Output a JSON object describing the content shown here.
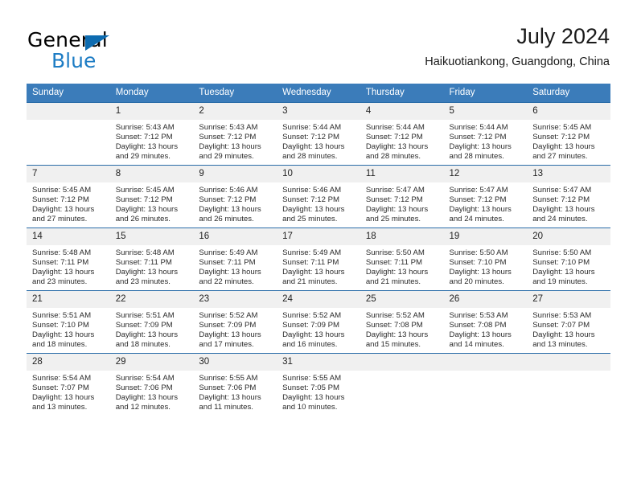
{
  "brand": {
    "name_top": "General",
    "name_bottom": "Blue",
    "triangle_color": "#0d6bb0",
    "blue_color": "#1d7cc4"
  },
  "header": {
    "title": "July 2024",
    "subtitle": "Haikuotiankong, Guangdong, China"
  },
  "theme": {
    "header_bg": "#3b7cba",
    "row_rule": "#2a6ca8",
    "daynum_bg": "#f0f0f0"
  },
  "weekdays": [
    "Sunday",
    "Monday",
    "Tuesday",
    "Wednesday",
    "Thursday",
    "Friday",
    "Saturday"
  ],
  "weeks": [
    [
      {
        "day": "",
        "sunrise": "",
        "sunset": "",
        "daylight1": "",
        "daylight2": ""
      },
      {
        "day": "1",
        "sunrise": "Sunrise: 5:43 AM",
        "sunset": "Sunset: 7:12 PM",
        "daylight1": "Daylight: 13 hours",
        "daylight2": "and 29 minutes."
      },
      {
        "day": "2",
        "sunrise": "Sunrise: 5:43 AM",
        "sunset": "Sunset: 7:12 PM",
        "daylight1": "Daylight: 13 hours",
        "daylight2": "and 29 minutes."
      },
      {
        "day": "3",
        "sunrise": "Sunrise: 5:44 AM",
        "sunset": "Sunset: 7:12 PM",
        "daylight1": "Daylight: 13 hours",
        "daylight2": "and 28 minutes."
      },
      {
        "day": "4",
        "sunrise": "Sunrise: 5:44 AM",
        "sunset": "Sunset: 7:12 PM",
        "daylight1": "Daylight: 13 hours",
        "daylight2": "and 28 minutes."
      },
      {
        "day": "5",
        "sunrise": "Sunrise: 5:44 AM",
        "sunset": "Sunset: 7:12 PM",
        "daylight1": "Daylight: 13 hours",
        "daylight2": "and 28 minutes."
      },
      {
        "day": "6",
        "sunrise": "Sunrise: 5:45 AM",
        "sunset": "Sunset: 7:12 PM",
        "daylight1": "Daylight: 13 hours",
        "daylight2": "and 27 minutes."
      }
    ],
    [
      {
        "day": "7",
        "sunrise": "Sunrise: 5:45 AM",
        "sunset": "Sunset: 7:12 PM",
        "daylight1": "Daylight: 13 hours",
        "daylight2": "and 27 minutes."
      },
      {
        "day": "8",
        "sunrise": "Sunrise: 5:45 AM",
        "sunset": "Sunset: 7:12 PM",
        "daylight1": "Daylight: 13 hours",
        "daylight2": "and 26 minutes."
      },
      {
        "day": "9",
        "sunrise": "Sunrise: 5:46 AM",
        "sunset": "Sunset: 7:12 PM",
        "daylight1": "Daylight: 13 hours",
        "daylight2": "and 26 minutes."
      },
      {
        "day": "10",
        "sunrise": "Sunrise: 5:46 AM",
        "sunset": "Sunset: 7:12 PM",
        "daylight1": "Daylight: 13 hours",
        "daylight2": "and 25 minutes."
      },
      {
        "day": "11",
        "sunrise": "Sunrise: 5:47 AM",
        "sunset": "Sunset: 7:12 PM",
        "daylight1": "Daylight: 13 hours",
        "daylight2": "and 25 minutes."
      },
      {
        "day": "12",
        "sunrise": "Sunrise: 5:47 AM",
        "sunset": "Sunset: 7:12 PM",
        "daylight1": "Daylight: 13 hours",
        "daylight2": "and 24 minutes."
      },
      {
        "day": "13",
        "sunrise": "Sunrise: 5:47 AM",
        "sunset": "Sunset: 7:12 PM",
        "daylight1": "Daylight: 13 hours",
        "daylight2": "and 24 minutes."
      }
    ],
    [
      {
        "day": "14",
        "sunrise": "Sunrise: 5:48 AM",
        "sunset": "Sunset: 7:11 PM",
        "daylight1": "Daylight: 13 hours",
        "daylight2": "and 23 minutes."
      },
      {
        "day": "15",
        "sunrise": "Sunrise: 5:48 AM",
        "sunset": "Sunset: 7:11 PM",
        "daylight1": "Daylight: 13 hours",
        "daylight2": "and 23 minutes."
      },
      {
        "day": "16",
        "sunrise": "Sunrise: 5:49 AM",
        "sunset": "Sunset: 7:11 PM",
        "daylight1": "Daylight: 13 hours",
        "daylight2": "and 22 minutes."
      },
      {
        "day": "17",
        "sunrise": "Sunrise: 5:49 AM",
        "sunset": "Sunset: 7:11 PM",
        "daylight1": "Daylight: 13 hours",
        "daylight2": "and 21 minutes."
      },
      {
        "day": "18",
        "sunrise": "Sunrise: 5:50 AM",
        "sunset": "Sunset: 7:11 PM",
        "daylight1": "Daylight: 13 hours",
        "daylight2": "and 21 minutes."
      },
      {
        "day": "19",
        "sunrise": "Sunrise: 5:50 AM",
        "sunset": "Sunset: 7:10 PM",
        "daylight1": "Daylight: 13 hours",
        "daylight2": "and 20 minutes."
      },
      {
        "day": "20",
        "sunrise": "Sunrise: 5:50 AM",
        "sunset": "Sunset: 7:10 PM",
        "daylight1": "Daylight: 13 hours",
        "daylight2": "and 19 minutes."
      }
    ],
    [
      {
        "day": "21",
        "sunrise": "Sunrise: 5:51 AM",
        "sunset": "Sunset: 7:10 PM",
        "daylight1": "Daylight: 13 hours",
        "daylight2": "and 18 minutes."
      },
      {
        "day": "22",
        "sunrise": "Sunrise: 5:51 AM",
        "sunset": "Sunset: 7:09 PM",
        "daylight1": "Daylight: 13 hours",
        "daylight2": "and 18 minutes."
      },
      {
        "day": "23",
        "sunrise": "Sunrise: 5:52 AM",
        "sunset": "Sunset: 7:09 PM",
        "daylight1": "Daylight: 13 hours",
        "daylight2": "and 17 minutes."
      },
      {
        "day": "24",
        "sunrise": "Sunrise: 5:52 AM",
        "sunset": "Sunset: 7:09 PM",
        "daylight1": "Daylight: 13 hours",
        "daylight2": "and 16 minutes."
      },
      {
        "day": "25",
        "sunrise": "Sunrise: 5:52 AM",
        "sunset": "Sunset: 7:08 PM",
        "daylight1": "Daylight: 13 hours",
        "daylight2": "and 15 minutes."
      },
      {
        "day": "26",
        "sunrise": "Sunrise: 5:53 AM",
        "sunset": "Sunset: 7:08 PM",
        "daylight1": "Daylight: 13 hours",
        "daylight2": "and 14 minutes."
      },
      {
        "day": "27",
        "sunrise": "Sunrise: 5:53 AM",
        "sunset": "Sunset: 7:07 PM",
        "daylight1": "Daylight: 13 hours",
        "daylight2": "and 13 minutes."
      }
    ],
    [
      {
        "day": "28",
        "sunrise": "Sunrise: 5:54 AM",
        "sunset": "Sunset: 7:07 PM",
        "daylight1": "Daylight: 13 hours",
        "daylight2": "and 13 minutes."
      },
      {
        "day": "29",
        "sunrise": "Sunrise: 5:54 AM",
        "sunset": "Sunset: 7:06 PM",
        "daylight1": "Daylight: 13 hours",
        "daylight2": "and 12 minutes."
      },
      {
        "day": "30",
        "sunrise": "Sunrise: 5:55 AM",
        "sunset": "Sunset: 7:06 PM",
        "daylight1": "Daylight: 13 hours",
        "daylight2": "and 11 minutes."
      },
      {
        "day": "31",
        "sunrise": "Sunrise: 5:55 AM",
        "sunset": "Sunset: 7:05 PM",
        "daylight1": "Daylight: 13 hours",
        "daylight2": "and 10 minutes."
      },
      {
        "day": "",
        "sunrise": "",
        "sunset": "",
        "daylight1": "",
        "daylight2": ""
      },
      {
        "day": "",
        "sunrise": "",
        "sunset": "",
        "daylight1": "",
        "daylight2": ""
      },
      {
        "day": "",
        "sunrise": "",
        "sunset": "",
        "daylight1": "",
        "daylight2": ""
      }
    ]
  ]
}
